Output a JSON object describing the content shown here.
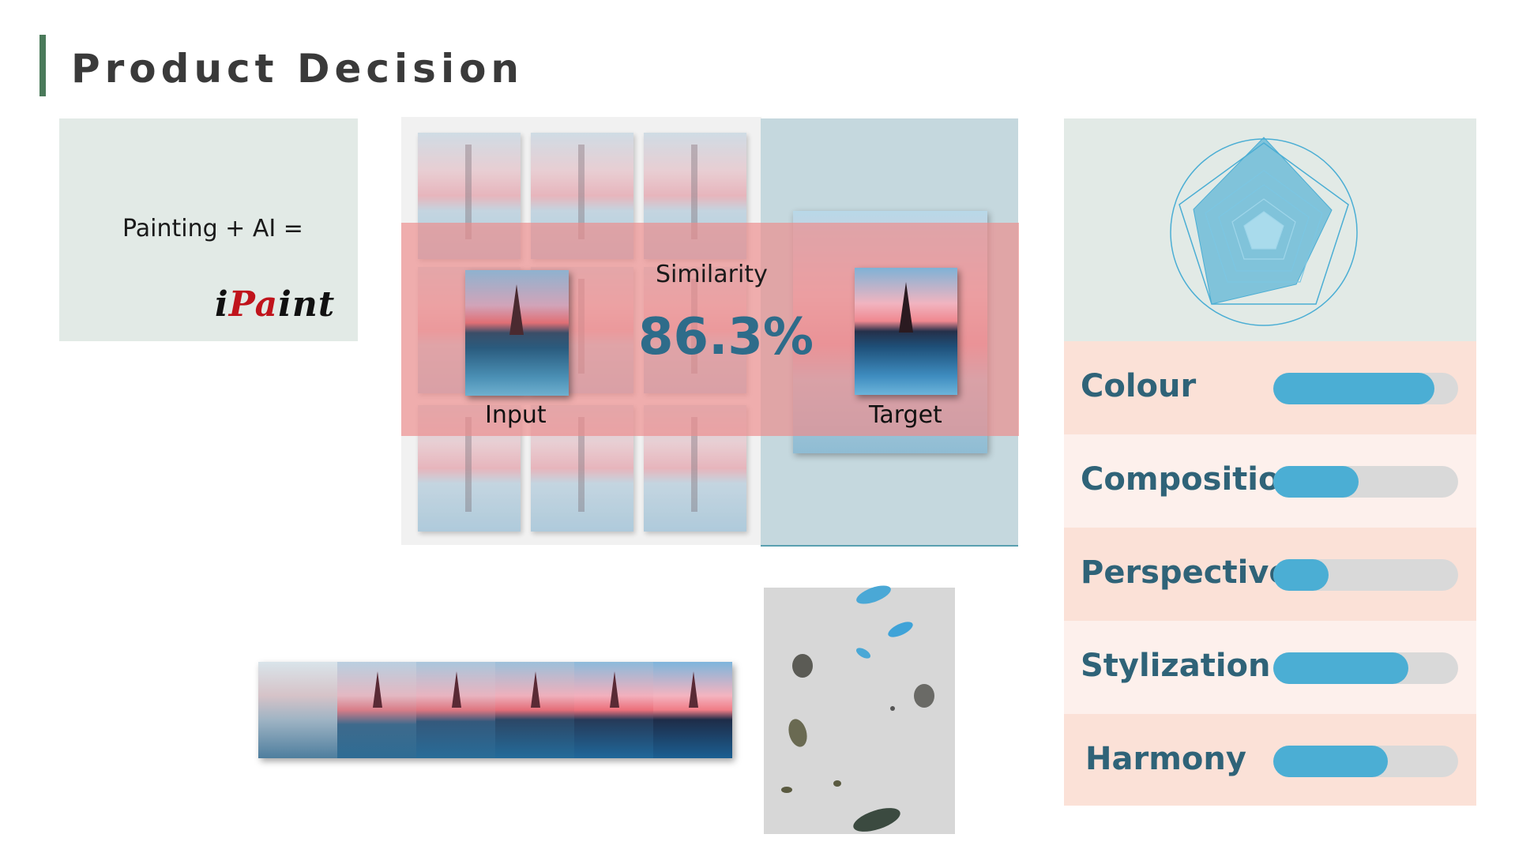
{
  "title": "Product Decision",
  "left_card": {
    "equation": "Painting + AI =",
    "logo": {
      "part1": "i",
      "part2": "Pa",
      "part3": "int"
    }
  },
  "center": {
    "similarity_label": "Similarity",
    "similarity_value": "86.3%",
    "input_label": "Input",
    "target_label": "Target"
  },
  "metrics": [
    {
      "label": "Colour",
      "value": 0.87,
      "bg": "#fbe1d7"
    },
    {
      "label": "Composition",
      "value": 0.46,
      "bg": "#fdf0ec"
    },
    {
      "label": "Perspective",
      "value": 0.3,
      "bg": "#fbe1d7"
    },
    {
      "label": "Stylization",
      "value": 0.73,
      "bg": "#fdf0ec"
    },
    {
      "label": "Harmony",
      "value": 0.62,
      "bg": "#fbe1d7"
    }
  ],
  "colors": {
    "accent": "#4baed4",
    "text_dark": "#2f6378",
    "title_bar": "#4a7a5a",
    "band": "#ee8c8c"
  }
}
